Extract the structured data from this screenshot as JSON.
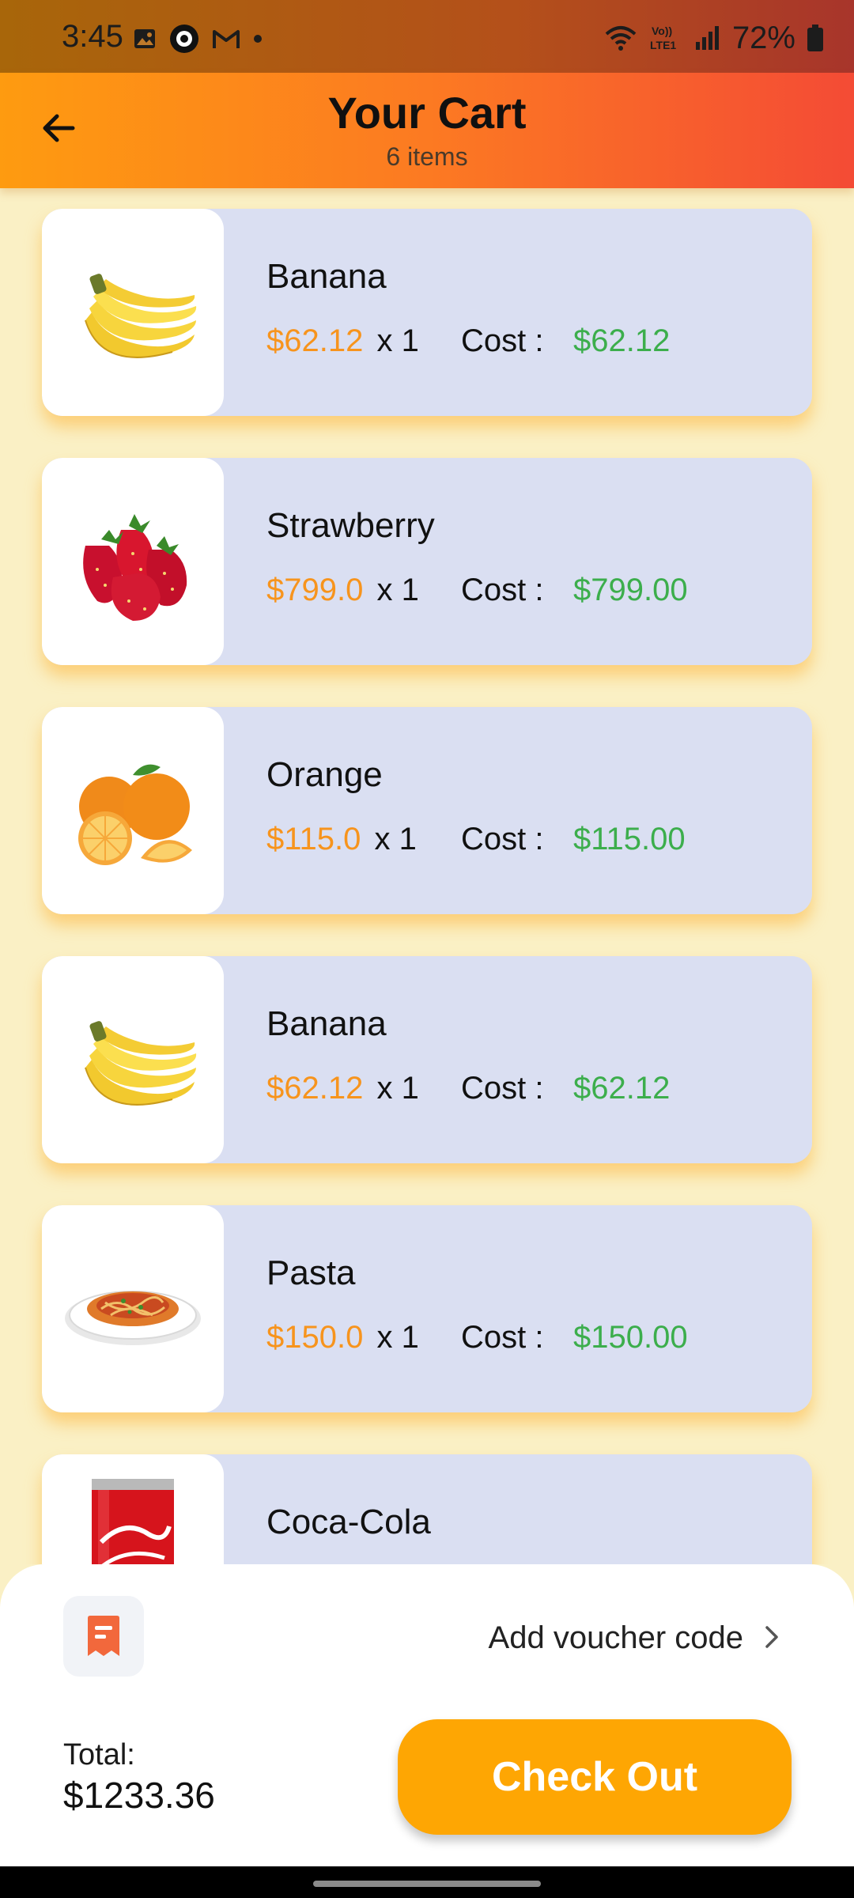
{
  "status_bar": {
    "time": "3:45",
    "battery": "72%",
    "network_label": "Vo)) LTE1",
    "icons": [
      "image-icon",
      "app-icon",
      "gmail-icon",
      "dot-icon",
      "wifi-icon",
      "lte-icon",
      "signal-icon",
      "battery-icon"
    ]
  },
  "header": {
    "title": "Your Cart",
    "subtitle": "6 items",
    "back_icon": "back-arrow-icon"
  },
  "cart": {
    "cost_label": "Cost :",
    "items": [
      {
        "name": "Banana",
        "price": "$62.12",
        "qty": "x 1",
        "cost": "$62.12",
        "image": "banana"
      },
      {
        "name": "Strawberry",
        "price": "$799.0",
        "qty": "x 1",
        "cost": "$799.00",
        "image": "strawberry"
      },
      {
        "name": "Orange",
        "price": "$115.0",
        "qty": "x 1",
        "cost": "$115.00",
        "image": "orange"
      },
      {
        "name": "Banana",
        "price": "$62.12",
        "qty": "x 1",
        "cost": "$62.12",
        "image": "banana"
      },
      {
        "name": "Pasta",
        "price": "$150.0",
        "qty": "x 1",
        "cost": "$150.00",
        "image": "pasta"
      },
      {
        "name": "Coca-Cola",
        "image": "coca-cola"
      }
    ]
  },
  "footer": {
    "voucher_label": "Add voucher code",
    "voucher_icon": "receipt-icon",
    "total_label": "Total:",
    "total_value": "$1233.36",
    "checkout_label": "Check Out"
  },
  "colors": {
    "accent": "#fea603",
    "price": "#f7941d",
    "cost": "#3cae4c",
    "card": "#dadff2",
    "background": "#faf0c5"
  }
}
